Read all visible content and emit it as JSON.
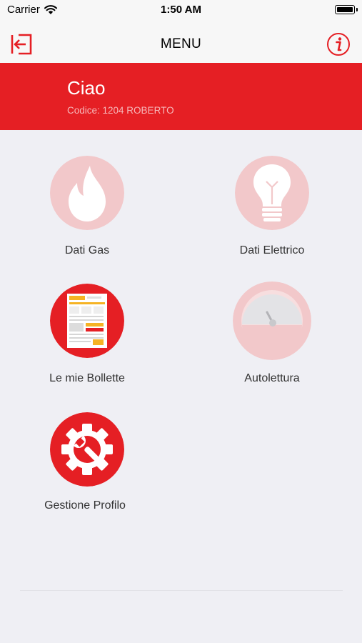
{
  "status_bar": {
    "carrier": "Carrier",
    "time": "1:50 AM",
    "wifi_icon": "wifi-icon",
    "battery_icon": "battery-icon"
  },
  "navbar": {
    "title": "MENU",
    "left_icon": "logout-icon",
    "right_icon": "info-icon"
  },
  "header": {
    "greeting": "Ciao",
    "code": "Codice: 1204 ROBERTO"
  },
  "menu": {
    "items": [
      {
        "label": "Dati Gas",
        "icon": "flame-icon",
        "enabled": false
      },
      {
        "label": "Dati Elettrico",
        "icon": "lightbulb-icon",
        "enabled": false
      },
      {
        "label": "Le mie Bollette",
        "icon": "bill-icon",
        "enabled": true
      },
      {
        "label": "Autolettura",
        "icon": "meter-gauge-icon",
        "enabled": false
      },
      {
        "label": "Gestione Profilo",
        "icon": "settings-gear-icon",
        "enabled": true
      }
    ]
  },
  "colors": {
    "brand_red": "#e51f24",
    "disabled_pink": "#f2c8ca",
    "background": "#efeff4"
  }
}
